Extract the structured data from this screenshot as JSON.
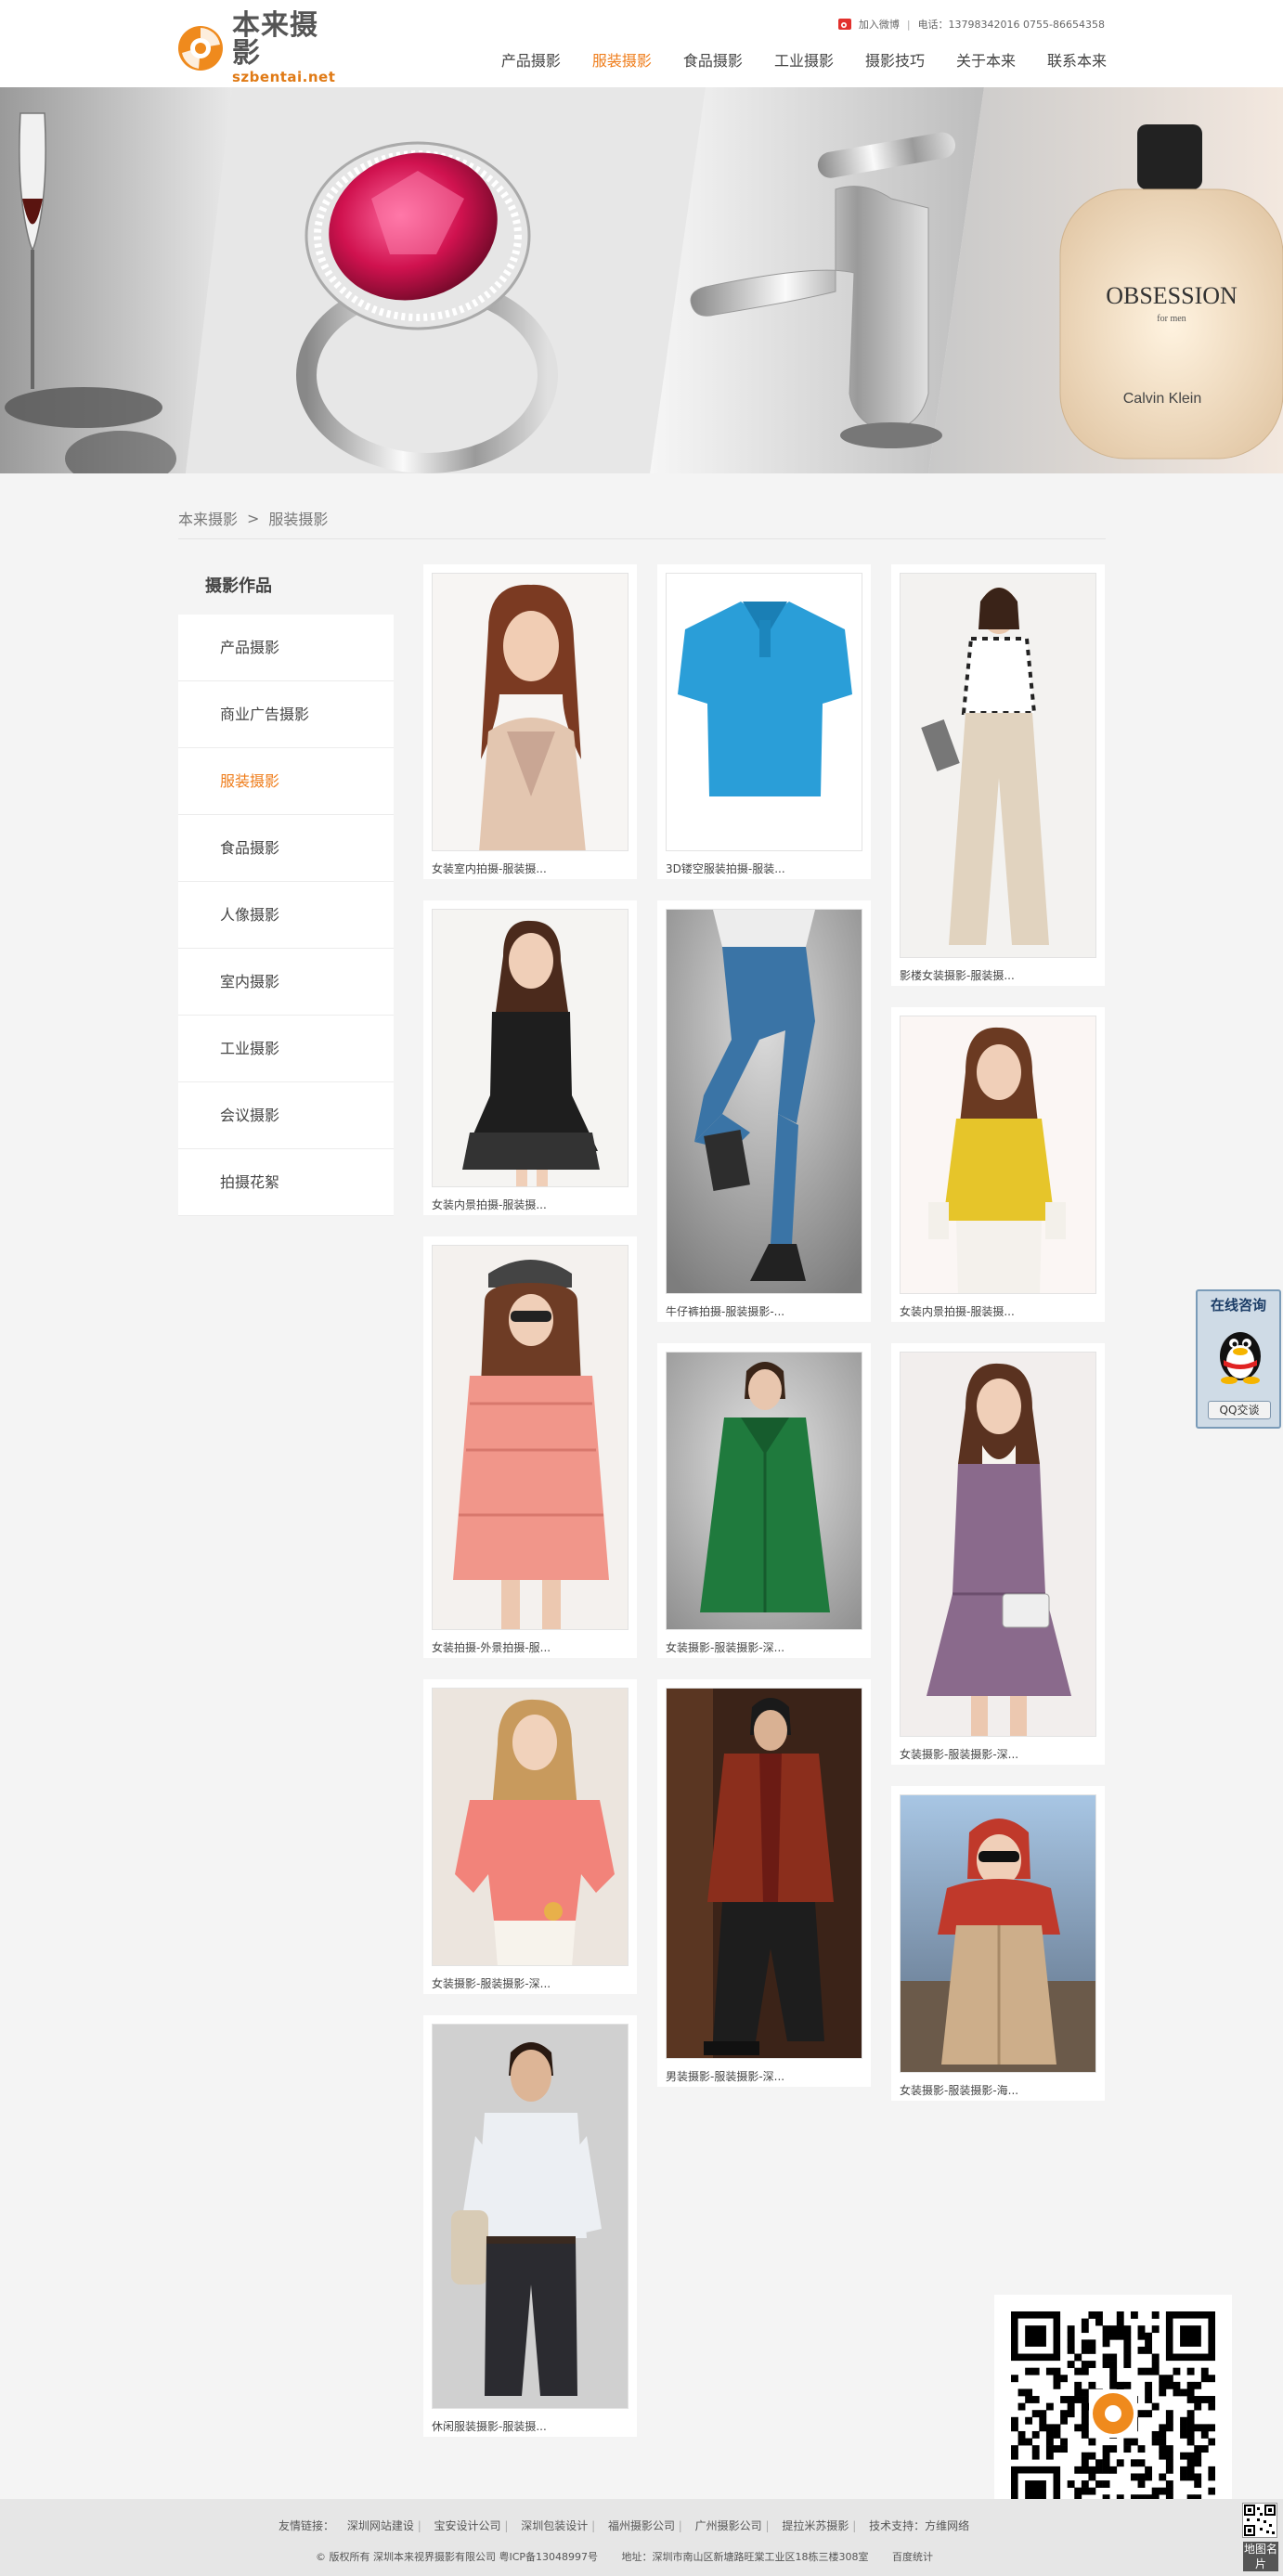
{
  "header": {
    "logo_cn": "本来摄影",
    "logo_en": "szbentai.net",
    "top_links": {
      "weibo": "加入微博",
      "phone": "电话：13798342016  0755-86654358"
    },
    "nav": [
      "产品摄影",
      "服装摄影",
      "食品摄影",
      "工业摄影",
      "摄影技巧",
      "关于本来",
      "联系本来"
    ],
    "nav_active_index": 1
  },
  "banner": {
    "perfume_brand_1": "OBSESSION",
    "perfume_brand_2": "for men",
    "perfume_brand_3": "Calvin Klein"
  },
  "breadcrumb": {
    "home": "本来摄影",
    "separator": ">",
    "current": "服装摄影"
  },
  "sidebar": {
    "title": "摄影作品",
    "items": [
      "产品摄影",
      "商业广告摄影",
      "服装摄影",
      "食品摄影",
      "人像摄影",
      "室内摄影",
      "工业摄影",
      "会议摄影",
      "拍摄花絮"
    ],
    "active_index": 2
  },
  "gallery": {
    "captions": [
      "女装室内拍摄-服装摄...",
      "3D镂空服装拍摄-服装...",
      "影楼女装摄影-服装摄...",
      "女装内景拍摄-服装摄...",
      "牛仔裤拍摄-服装摄影-...",
      "女装内景拍摄-服装摄...",
      "女装拍摄-外景拍摄-服...",
      "女装摄影-服装摄影-深...",
      "女装摄影-服装摄影-深...",
      "女装摄影-服装摄影-深...",
      "男装摄影-服装摄影-深...",
      "女装摄影-服装摄影-海...",
      "休闲服装摄影-服装摄..."
    ]
  },
  "widgets": {
    "online_title": "在线咨询",
    "qq_button": "QQ交谈",
    "map_name": "地图名片"
  },
  "footer": {
    "friend_links_label": "友情链接：",
    "friend_links": [
      "深圳网站建设",
      "宝安设计公司",
      "深圳包装设计",
      "福州摄影公司",
      "广州摄影公司",
      "提拉米苏摄影"
    ],
    "tech_support": "技术支持：方维网络",
    "copyright": "© 版权所有  深圳本来视界摄影有限公司  粤ICP备13048997号",
    "address": "地址：深圳市南山区新塘路旺棠工业区18栋三楼308室",
    "stats": "百度统计"
  }
}
